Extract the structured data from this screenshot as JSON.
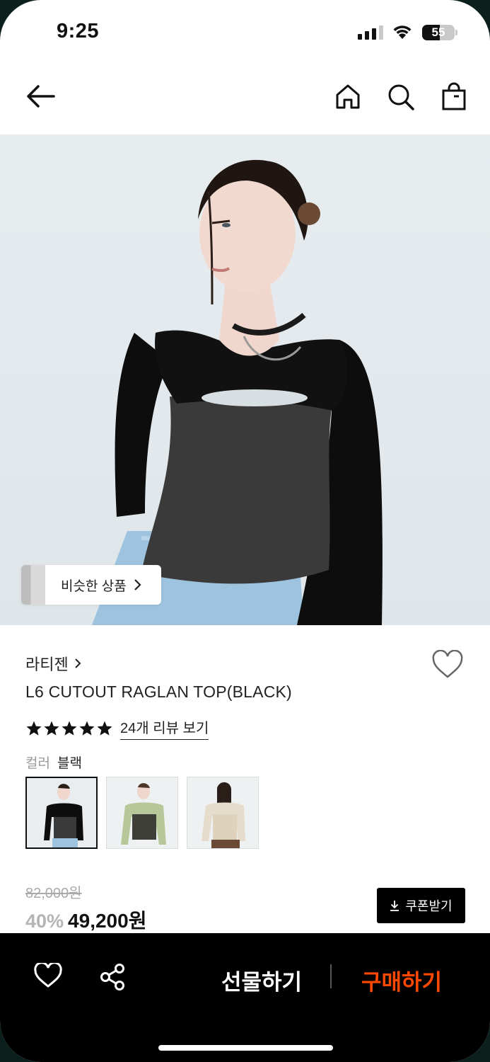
{
  "status_bar": {
    "time": "9:25",
    "battery": "55"
  },
  "nav": {
    "back_icon": "back-arrow-icon",
    "home_icon": "home-icon",
    "search_icon": "search-icon",
    "bag_icon": "shopping-bag-icon"
  },
  "hero": {
    "similar_label": "비슷한 상품"
  },
  "product": {
    "brand": "라티젠",
    "title": "L6 CUTOUT RAGLAN TOP(BLACK)",
    "rating_stars": 5,
    "review_link": "24개 리뷰 보기",
    "color_key": "컬러",
    "color_value": "블랙",
    "original_price": "82,000원",
    "discount": "40%",
    "price": "49,200원",
    "coupon_label": "쿠폰받기"
  },
  "bottom_bar": {
    "gift_label": "선물하기",
    "buy_label": "구매하기"
  },
  "colors": {
    "accent": "#ff4800",
    "dark": "#000000",
    "hero_bg": "#e4eaed"
  }
}
